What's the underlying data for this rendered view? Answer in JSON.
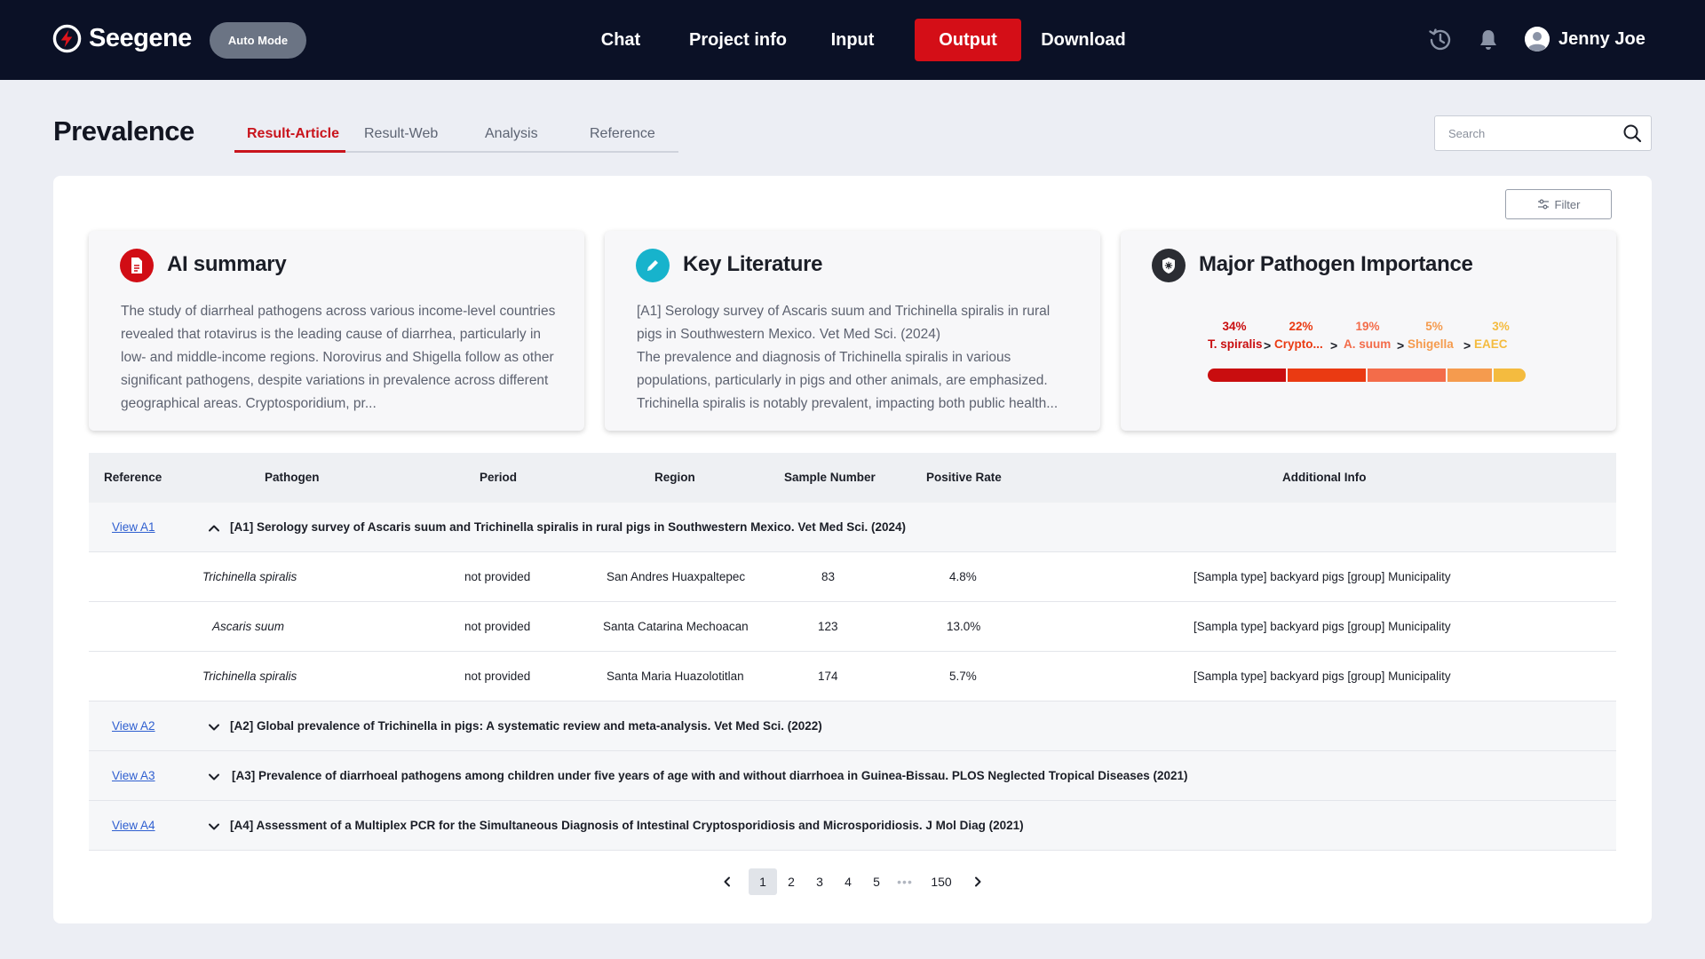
{
  "app": {
    "logo_text": "Seegene",
    "mode_label": "Auto Mode"
  },
  "nav": {
    "items": [
      "Chat",
      "Project info",
      "Input",
      "Output",
      "Download"
    ],
    "active": "Output",
    "accent": "#d40e17"
  },
  "user": {
    "name": "Jenny Joe"
  },
  "page": {
    "title": "Prevalence",
    "tabs": [
      "Result-Article",
      "Result-Web",
      "Analysis",
      "Reference"
    ],
    "active_tab": "Result-Article",
    "search_placeholder": "Search",
    "filter_label": "Filter"
  },
  "cards": {
    "ai_summary": {
      "title": "AI summary",
      "text": "The study of diarrheal pathogens across various income-level countries revealed that rotavirus is the leading cause of diarrhea, particularly in low- and middle-income regions. Norovirus and Shigella follow as other significant pathogens, despite variations in prevalence across different geographical areas. Cryptosporidium, pr..."
    },
    "key_literature": {
      "title": "Key Literature",
      "text": "[A1] Serology survey of Ascaris suum and Trichinella spiralis in rural pigs in Southwestern Mexico. Vet Med Sci. (2024)\nThe prevalence and diagnosis of Trichinella spiralis in various populations, particularly in pigs and other animals, are emphasized. Trichinella spiralis is notably prevalent, impacting both public health..."
    },
    "pathogen_importance": {
      "title": "Major Pathogen Importance",
      "items": [
        {
          "percent": "34%",
          "name": "T. spiralis",
          "value": 34,
          "color": "#c90d0f"
        },
        {
          "percent": "22%",
          "name": "Crypto...",
          "value": 22,
          "color": "#ea3a12"
        },
        {
          "percent": "19%",
          "name": "A. suum",
          "value": 19,
          "color": "#f36c4a"
        },
        {
          "percent": "5%",
          "name": "Shigella",
          "value": 5,
          "color": "#f59b4e"
        },
        {
          "percent": "3%",
          "name": "EAEC",
          "value": 3,
          "color": "#f4bb3f"
        }
      ],
      "separator": ">"
    }
  },
  "table": {
    "headers": {
      "reference": "Reference",
      "pathogen": "Pathogen",
      "period": "Period",
      "region": "Region",
      "sample_number": "Sample Number",
      "positive_rate": "Positive Rate",
      "additional_info": "Additional Info"
    },
    "groups": [
      {
        "view": "View A1",
        "title": "[A1] Serology survey of Ascaris suum and Trichinella spiralis in rural pigs in Southwestern Mexico. Vet Med Sci. (2024)",
        "expanded": true,
        "rows": [
          {
            "pathogen": "Trichinella spiralis",
            "period": "not provided",
            "region": "San Andres Huaxpaltepec",
            "sample_number": "83",
            "positive_rate": "4.8%",
            "additional_info": "[Sampla type] backyard pigs [group] Municipality"
          },
          {
            "pathogen": "Ascaris suum",
            "period": "not provided",
            "region": "Santa Catarina Mechoacan",
            "sample_number": "123",
            "positive_rate": "13.0%",
            "additional_info": "[Sampla type] backyard pigs [group] Municipality"
          },
          {
            "pathogen": "Trichinella spiralis",
            "period": "not provided",
            "region": "Santa Maria Huazolotitlan",
            "sample_number": "174",
            "positive_rate": "5.7%",
            "additional_info": "[Sampla type] backyard pigs [group] Municipality"
          }
        ]
      },
      {
        "view": "View A2",
        "title": "[A2] Global prevalence of Trichinella in pigs: A systematic review and meta-analysis. Vet Med Sci. (2022)",
        "expanded": false
      },
      {
        "view": "View A3",
        "title": "[A3] Prevalence of diarrhoeal pathogens among children under five years of age with and without diarrhoea in Guinea-Bissau. PLOS Neglected Tropical Diseases (2021)",
        "expanded": false
      },
      {
        "view": "View A4",
        "title": "[A4] Assessment of a Multiplex PCR for the Simultaneous Diagnosis of Intestinal Cryptosporidiosis and Microsporidiosis. J Mol Diag (2021)",
        "expanded": false
      }
    ]
  },
  "pagination": {
    "pages": [
      "1",
      "2",
      "3",
      "4",
      "5"
    ],
    "ellipsis": "•••",
    "last": "150",
    "current": "1"
  }
}
